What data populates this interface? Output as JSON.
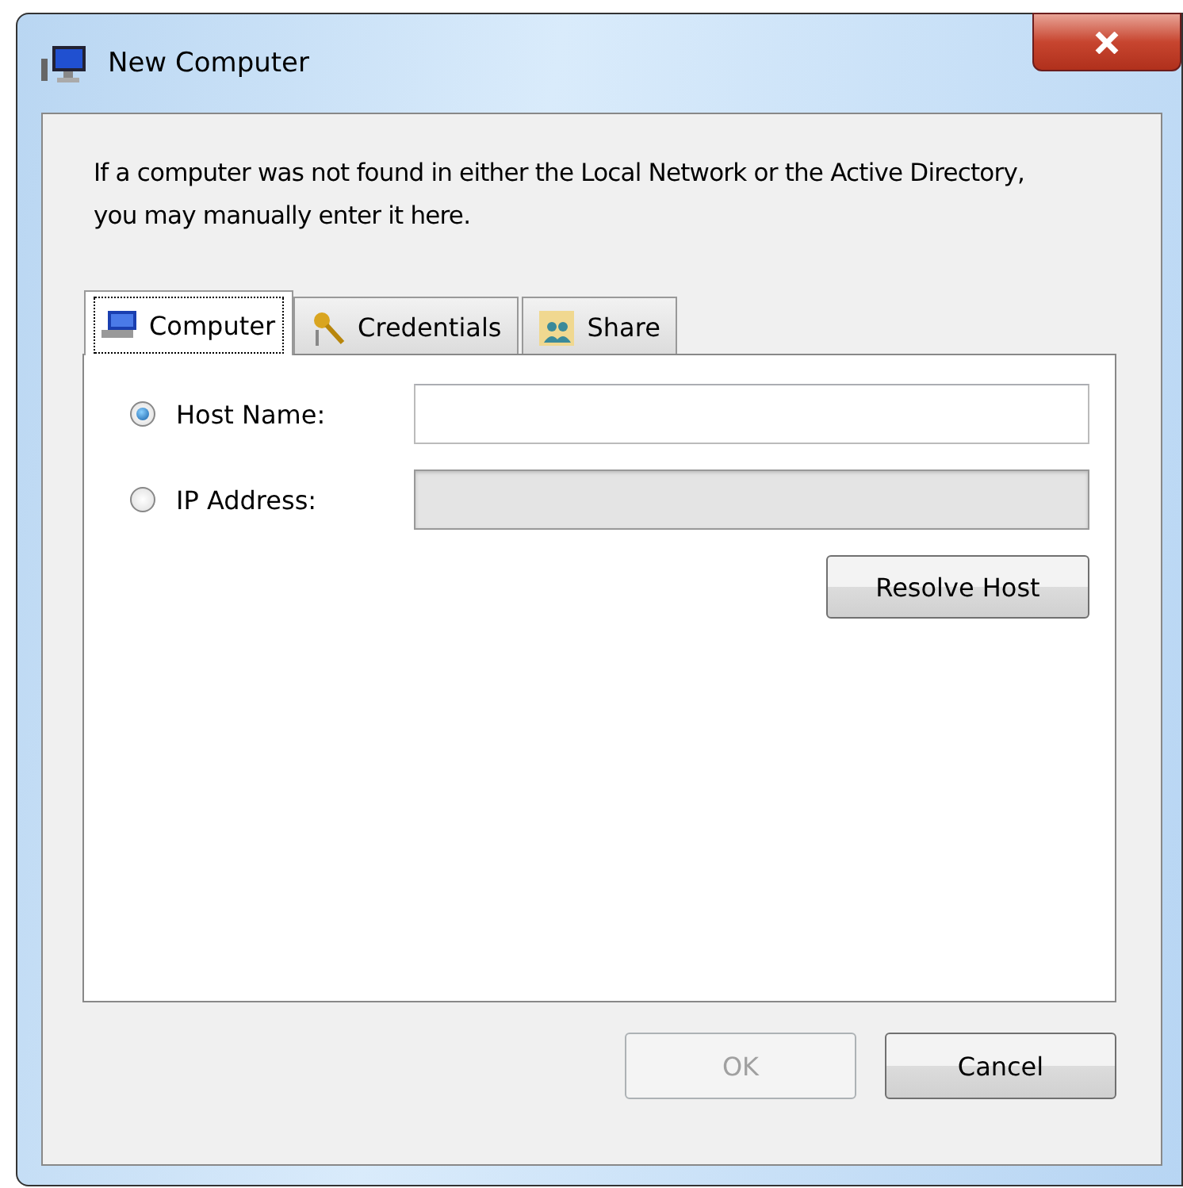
{
  "window": {
    "title": "New Computer"
  },
  "description": "If a computer was not found in either the Local Network or the Active Directory, you may manually enter it here.",
  "tabs": [
    {
      "label": "Computer",
      "selected": true
    },
    {
      "label": "Credentials",
      "selected": false
    },
    {
      "label": "Share",
      "selected": false
    }
  ],
  "options": [
    {
      "label": "Host Name:",
      "selected": true,
      "disabled": false
    },
    {
      "label": "IP Address:",
      "selected": false,
      "disabled": true
    }
  ],
  "resolve_button": {
    "label": "Resolve Host"
  },
  "buttons": [
    {
      "label": "OK",
      "disabled": true
    },
    {
      "label": "Cancel",
      "disabled": false
    }
  ]
}
